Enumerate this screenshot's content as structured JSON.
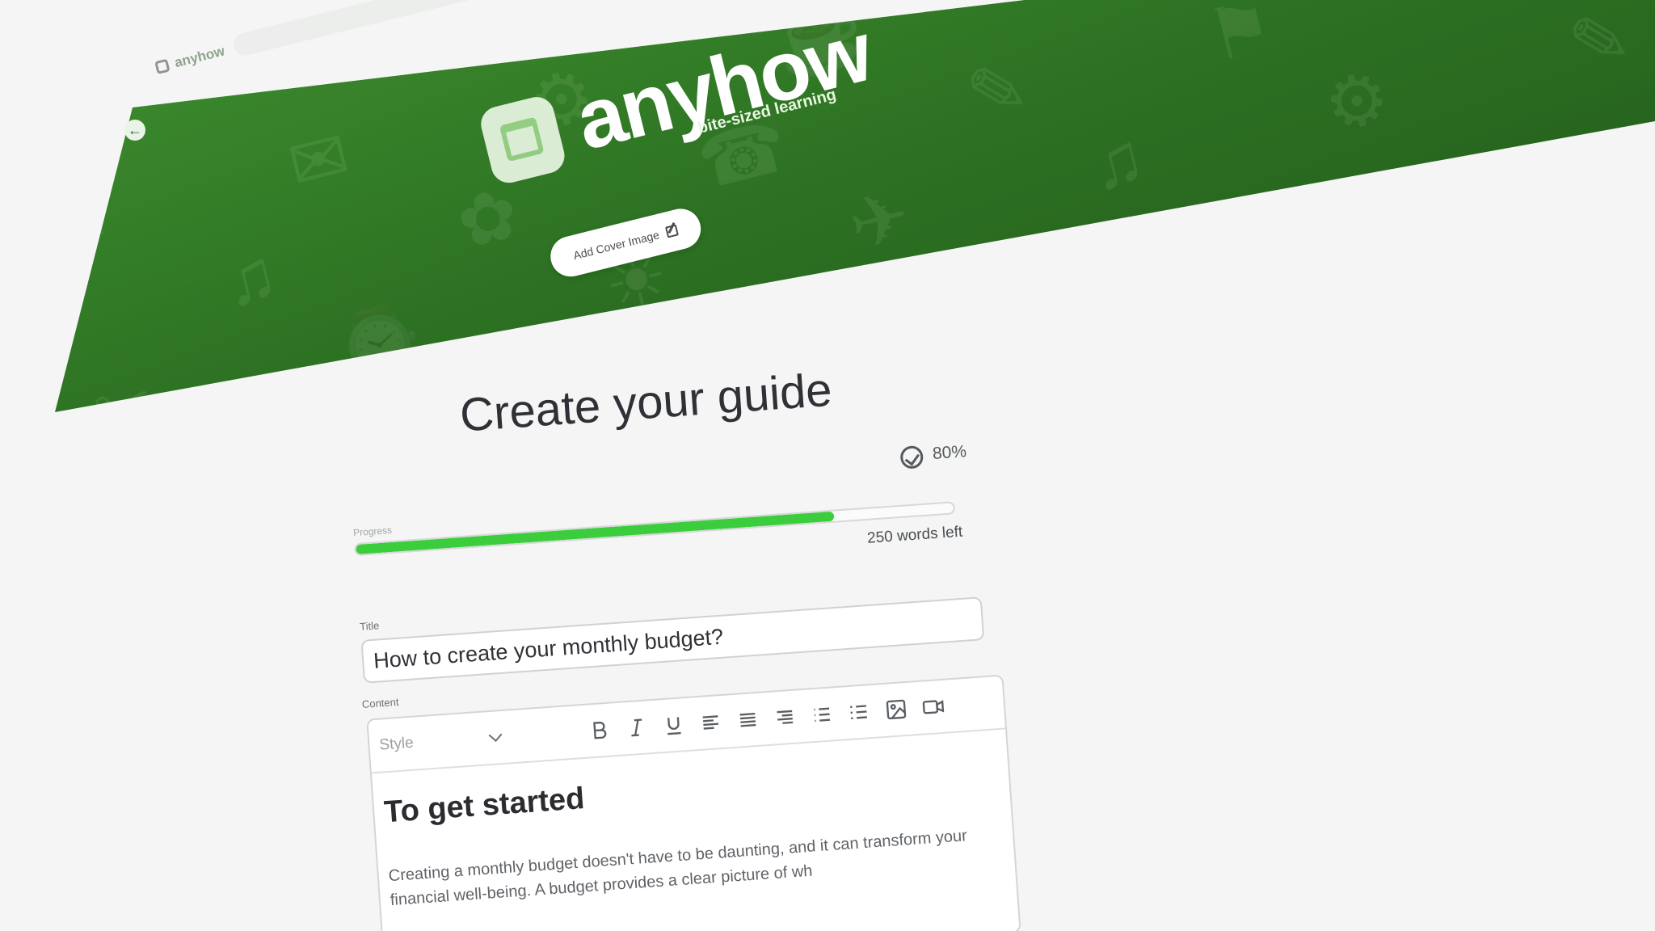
{
  "browser": {
    "logo_text": "anyhow",
    "url_text": ""
  },
  "hero": {
    "back_icon": "←",
    "brand_name": "anyhow",
    "brand_tagline": "bite-sized learning",
    "cover_button_label": "Add Cover Image",
    "accent_color": "#2c7022"
  },
  "page": {
    "title": "Create your guide"
  },
  "progress": {
    "label": "Progress",
    "percent_text": "80%",
    "fraction": 0.8,
    "words_left": "250 words left",
    "fill_color": "#3ccd3c"
  },
  "title_field": {
    "label": "Title",
    "value": "How to create your monthly budget?"
  },
  "content": {
    "label": "Content",
    "style_placeholder": "Style",
    "toolbar": [
      "bold-icon",
      "italic-icon",
      "underline-icon",
      "align-left-icon",
      "align-justify-icon",
      "align-right-icon",
      "bullet-list-icon",
      "list-icon",
      "image-icon",
      "video-icon"
    ],
    "heading": "To get started",
    "paragraph": "Creating a monthly budget doesn't have to be daunting, and it can transform your financial well-being. A budget provides a clear picture of wh"
  }
}
